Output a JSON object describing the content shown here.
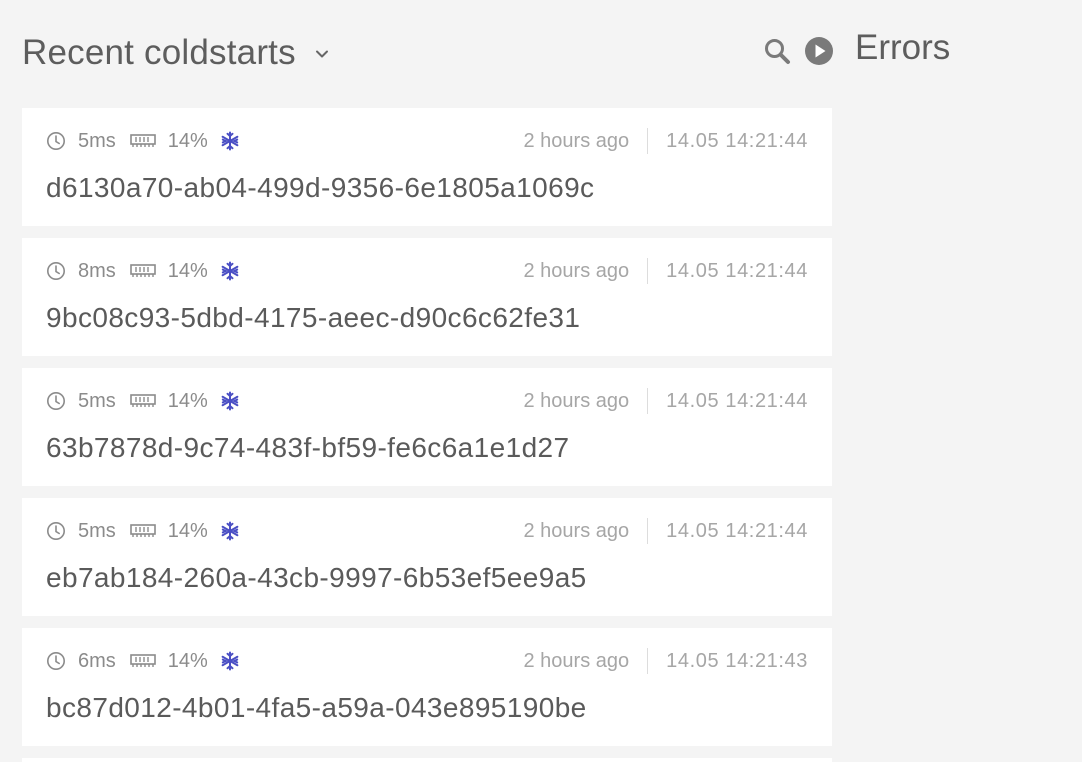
{
  "header": {
    "title": "Recent coldstarts",
    "errors_title": "Errors",
    "icons": {
      "dropdown": "chevron-down-icon",
      "search": "search-icon",
      "play": "play-icon"
    }
  },
  "colors": {
    "background": "#f4f4f4",
    "card": "#ffffff",
    "snowflake": "#4a4fc4",
    "muted_text": "#a6a6a6",
    "meta_text": "#8b8b8b"
  },
  "coldstarts": [
    {
      "duration": "5ms",
      "memory": "14%",
      "ago": "2 hours ago",
      "timestamp": "14.05 14:21:44",
      "id": "d6130a70-ab04-499d-9356-6e1805a1069c"
    },
    {
      "duration": "8ms",
      "memory": "14%",
      "ago": "2 hours ago",
      "timestamp": "14.05 14:21:44",
      "id": "9bc08c93-5dbd-4175-aeec-d90c6c62fe31"
    },
    {
      "duration": "5ms",
      "memory": "14%",
      "ago": "2 hours ago",
      "timestamp": "14.05 14:21:44",
      "id": "63b7878d-9c74-483f-bf59-fe6c6a1e1d27"
    },
    {
      "duration": "5ms",
      "memory": "14%",
      "ago": "2 hours ago",
      "timestamp": "14.05 14:21:44",
      "id": "eb7ab184-260a-43cb-9997-6b53ef5ee9a5"
    },
    {
      "duration": "6ms",
      "memory": "14%",
      "ago": "2 hours ago",
      "timestamp": "14.05 14:21:43",
      "id": "bc87d012-4b01-4fa5-a59a-043e895190be"
    }
  ]
}
